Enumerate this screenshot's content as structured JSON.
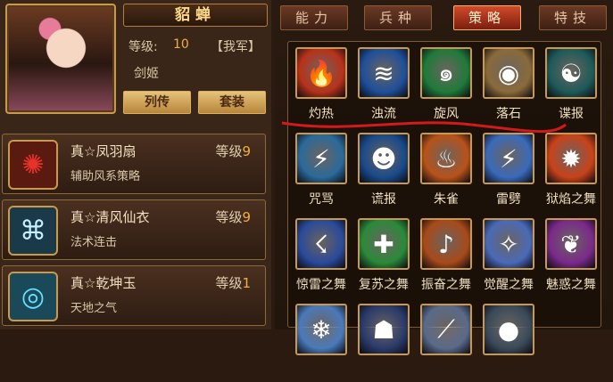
{
  "character": {
    "name": "貂蝉",
    "level_label": "等级:",
    "level_value": "10",
    "faction": "【我军】",
    "class": "剑姬"
  },
  "buttons": {
    "biography": "列传",
    "outfit": "套装"
  },
  "equipment": [
    {
      "name": "真☆凤羽扇",
      "level_label": "等级",
      "level": "9",
      "desc": "辅助风系策略",
      "icon": "feather-fan-icon"
    },
    {
      "name": "真☆清风仙衣",
      "level_label": "等级",
      "level": "9",
      "desc": "法术连击",
      "icon": "robe-icon"
    },
    {
      "name": "真☆乾坤玉",
      "level_label": "等级",
      "level": "1",
      "desc": "天地之气",
      "icon": "jade-icon"
    }
  ],
  "tabs": [
    {
      "label": "能力",
      "active": false
    },
    {
      "label": "兵种",
      "active": false
    },
    {
      "label": "策略",
      "active": true
    },
    {
      "label": "特技",
      "active": false
    }
  ],
  "skills": [
    {
      "label": "灼热",
      "icon": "fire-icon",
      "color": "#b8321a"
    },
    {
      "label": "浊流",
      "icon": "water-icon",
      "color": "#1f4f9a"
    },
    {
      "label": "旋风",
      "icon": "whirlwind-icon",
      "color": "#1f7a3a"
    },
    {
      "label": "落石",
      "icon": "rock-icon",
      "color": "#8a6a3a"
    },
    {
      "label": "谍报",
      "icon": "yinyang-icon",
      "color": "#1e5a5a"
    },
    {
      "label": "咒骂",
      "icon": "curse-icon",
      "color": "#2a6a9a"
    },
    {
      "label": "谎报",
      "icon": "false-report-icon",
      "color": "#1a4a8a"
    },
    {
      "label": "朱雀",
      "icon": "phoenix-icon",
      "color": "#b8521a"
    },
    {
      "label": "雷劈",
      "icon": "lightning-icon",
      "color": "#3a6aba"
    },
    {
      "label": "狱焰之舞",
      "icon": "hellfire-icon",
      "color": "#c8421a"
    },
    {
      "label": "惊雷之舞",
      "icon": "thunder-dance-icon",
      "color": "#2a4a9a"
    },
    {
      "label": "复苏之舞",
      "icon": "revive-icon",
      "color": "#2a8a3a"
    },
    {
      "label": "振奋之舞",
      "icon": "inspire-icon",
      "color": "#a84a1a"
    },
    {
      "label": "觉醒之舞",
      "icon": "awaken-icon",
      "color": "#4a6ab8"
    },
    {
      "label": "魅惑之舞",
      "icon": "charm-icon",
      "color": "#7a2a8a"
    },
    {
      "label": "",
      "icon": "ice-icon",
      "color": "#4a7aba"
    },
    {
      "label": "",
      "icon": "shadow-icon",
      "color": "#2a3a6a"
    },
    {
      "label": "",
      "icon": "slash-icon",
      "color": "#5a6a8a"
    },
    {
      "label": "",
      "icon": "orb-icon",
      "color": "#3a4a5a"
    }
  ],
  "annotation_color": "#d11a1a"
}
